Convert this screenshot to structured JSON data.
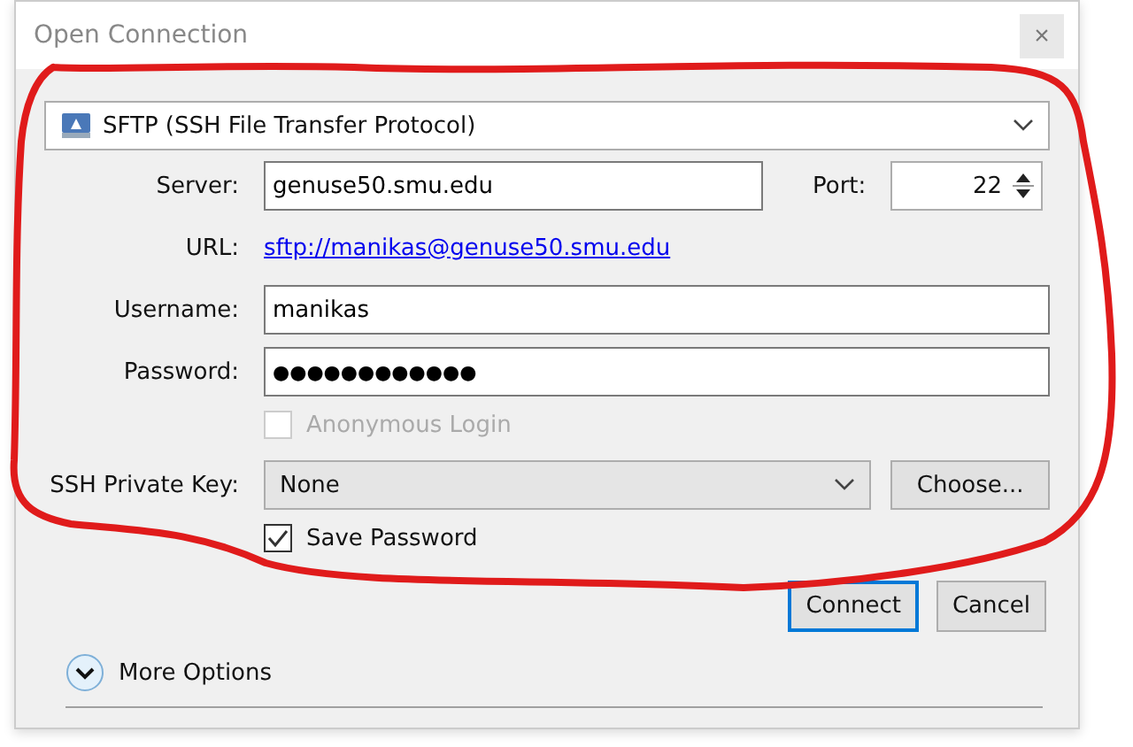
{
  "window": {
    "title": "Open Connection",
    "close": "×"
  },
  "protocol": {
    "value": "SFTP (SSH File Transfer Protocol)"
  },
  "server": {
    "label": "Server:",
    "value": "genuse50.smu.edu"
  },
  "port": {
    "label": "Port:",
    "value": "22"
  },
  "url": {
    "label": "URL:",
    "value": "sftp://manikas@genuse50.smu.edu"
  },
  "username": {
    "label": "Username:",
    "value": "manikas"
  },
  "password": {
    "label": "Password:",
    "value": "●●●●●●●●●●●●"
  },
  "anonymous": {
    "label": "Anonymous Login",
    "checked": false,
    "disabled": true
  },
  "private_key": {
    "label": "SSH Private Key:",
    "value": "None",
    "button": "Choose..."
  },
  "save_password": {
    "label": "Save Password",
    "checked": true,
    "disabled": false
  },
  "buttons": [
    {
      "label": "Connect",
      "selected": true
    },
    {
      "label": "Cancel",
      "selected": false
    }
  ],
  "more_options": {
    "label": "More Options",
    "expanded": false
  }
}
